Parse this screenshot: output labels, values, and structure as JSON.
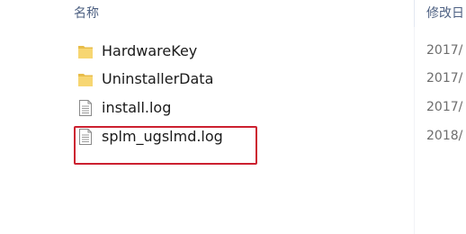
{
  "columns": {
    "name_label": "名称",
    "date_label": "修改日"
  },
  "files": [
    {
      "name": "HardwareKey",
      "type": "folder",
      "icon": "folder-icon",
      "date": "2017/"
    },
    {
      "name": "UninstallerData",
      "type": "folder",
      "icon": "folder-icon",
      "date": "2017/"
    },
    {
      "name": "install.log",
      "type": "file",
      "icon": "text-file-icon",
      "date": "2017/"
    },
    {
      "name": "splm_ugslmd.log",
      "type": "file",
      "icon": "text-file-icon",
      "date": "2018/"
    }
  ],
  "highlight": {
    "target": "splm_ugslmd.log",
    "color": "#cc2030"
  },
  "colors": {
    "folder": "#f7d672",
    "folder_dark": "#e8bd4a",
    "header_text": "#4d6082"
  }
}
